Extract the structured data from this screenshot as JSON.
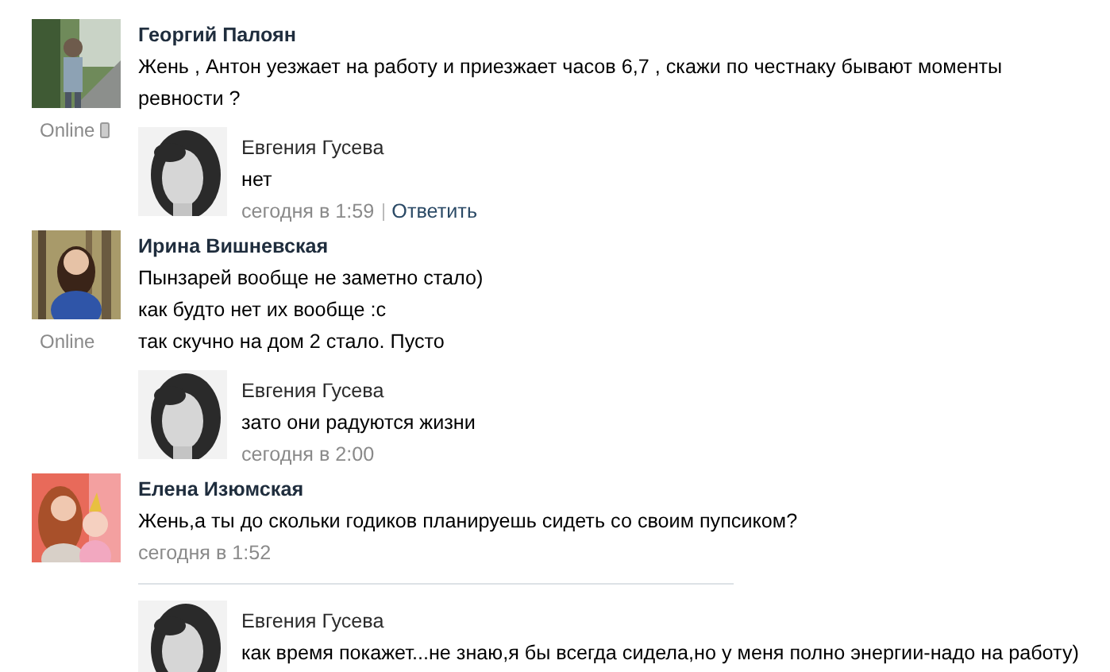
{
  "comments": [
    {
      "author": "Георгий Палоян",
      "lines": [
        "Жень , Антон уезжает на работу и приезжает часов 6,7 , скажи по честнаку бывают моменты ревности ?"
      ],
      "online": {
        "label": "Online",
        "mobile": true
      },
      "replies": [
        {
          "author": "Евгения Гусева",
          "lines": [
            "нет"
          ],
          "time": "сегодня в 1:59",
          "reply_link": "Ответить"
        }
      ]
    },
    {
      "author": "Ирина Вишневская",
      "lines": [
        "Пынзарей вообще не заметно стало)",
        "как будто нет их вообще :с",
        "так скучно на дом 2 стало. Пусто"
      ],
      "online": {
        "label": "Online"
      },
      "replies": [
        {
          "author": "Евгения Гусева",
          "lines": [
            "зато они радуются жизни"
          ],
          "time": "сегодня в 2:00"
        }
      ]
    },
    {
      "author": "Елена Изюмская",
      "lines": [
        "Жень,а ты до скольки годиков планируешь сидеть со своим пупсиком?"
      ],
      "time": "сегодня в 1:52",
      "divider": true,
      "replies": [
        {
          "author": "Евгения Гусева",
          "lines": [
            "как время покажет...не знаю,я бы всегда сидела,но у меня полно энергии-надо на работу)"
          ]
        }
      ]
    }
  ]
}
